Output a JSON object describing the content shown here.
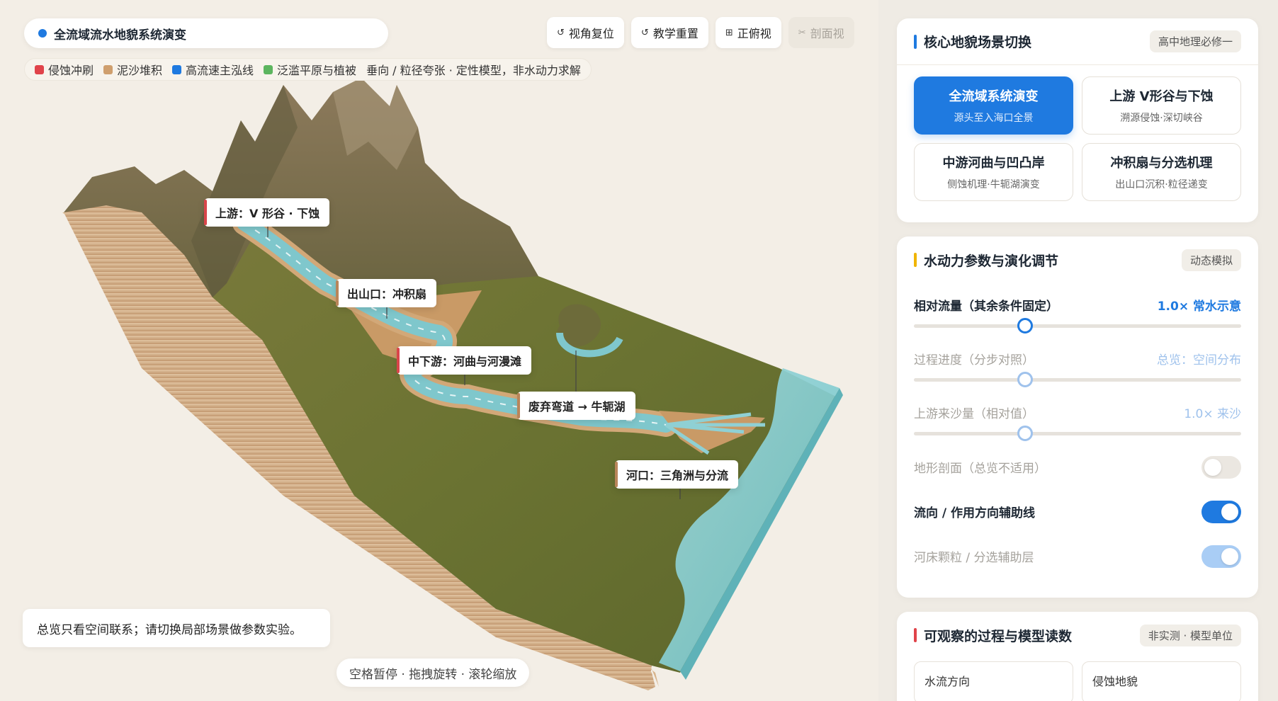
{
  "header": {
    "title": "全流域流水地貌系统演变",
    "toolbar": [
      {
        "icon": "↺",
        "label": "视角复位",
        "enabled": true
      },
      {
        "icon": "↺",
        "label": "教学重置",
        "enabled": true
      },
      {
        "icon": "⊞",
        "label": "正俯视",
        "enabled": true
      },
      {
        "icon": "✂",
        "label": "剖面视",
        "enabled": false
      }
    ]
  },
  "legend": {
    "items": [
      {
        "label": "侵蚀冲刷",
        "color": "#e0434a"
      },
      {
        "label": "泥沙堆积",
        "color": "#cf9f6e"
      },
      {
        "label": "高流速主泓线",
        "color": "#1f7ae0"
      },
      {
        "label": "泛滥平原与植被",
        "color": "#5cb55f"
      }
    ],
    "note": "垂向 / 粒径夸张 · 定性模型，非水动力求解"
  },
  "callouts": {
    "upstream": "上游：V 形谷 · 下蚀",
    "outlet": "出山口：冲积扇",
    "middle": "中下游：河曲与河漫滩",
    "oxbow": "废弃弯道 → 牛轭湖",
    "delta": "河口：三角洲与分流"
  },
  "hint": "总览只看空间联系；请切换局部场景做参数实验。",
  "key_hint": "空格暂停 · 拖拽旋转 · 滚轮缩放",
  "scenes": {
    "title": "核心地貌场景切换",
    "badge": "高中地理必修一",
    "accent": "#1f7ae0",
    "items": [
      {
        "title": "全流域系统演变",
        "sub": "源头至入海口全景",
        "active": true
      },
      {
        "title": "上游 V形谷与下蚀",
        "sub": "溯源侵蚀·深切峡谷",
        "active": false
      },
      {
        "title": "中游河曲与凹凸岸",
        "sub": "侧蚀机理·牛轭湖演变",
        "active": false
      },
      {
        "title": "冲积扇与分选机理",
        "sub": "出山口沉积·粒径递变",
        "active": false
      }
    ]
  },
  "params": {
    "title": "水动力参数与演化调节",
    "badge": "动态模拟",
    "accent": "#f0b400",
    "sliders": [
      {
        "label": "相对流量（其余条件固定）",
        "value": "1.0× 常水示意",
        "level": 0.34,
        "enabled": true
      },
      {
        "label": "过程进度（分步对照）",
        "value": "总览：空间分布",
        "level": 0.34,
        "enabled": false
      },
      {
        "label": "上游来沙量（相对值）",
        "value": "1.0× 来沙",
        "level": 0.34,
        "enabled": false
      }
    ],
    "toggles": [
      {
        "label": "地形剖面（总览不适用）",
        "on": false,
        "enabled": false
      },
      {
        "label": "流向 / 作用方向辅助线",
        "on": true,
        "enabled": true
      },
      {
        "label": "河床颗粒 / 分选辅助层",
        "on": true,
        "enabled": false
      }
    ]
  },
  "observe": {
    "title": "可观察的过程与模型读数",
    "badge": "非实测 · 模型单位",
    "accent": "#e0434a",
    "items": [
      "水流方向",
      "侵蚀地貌"
    ]
  }
}
